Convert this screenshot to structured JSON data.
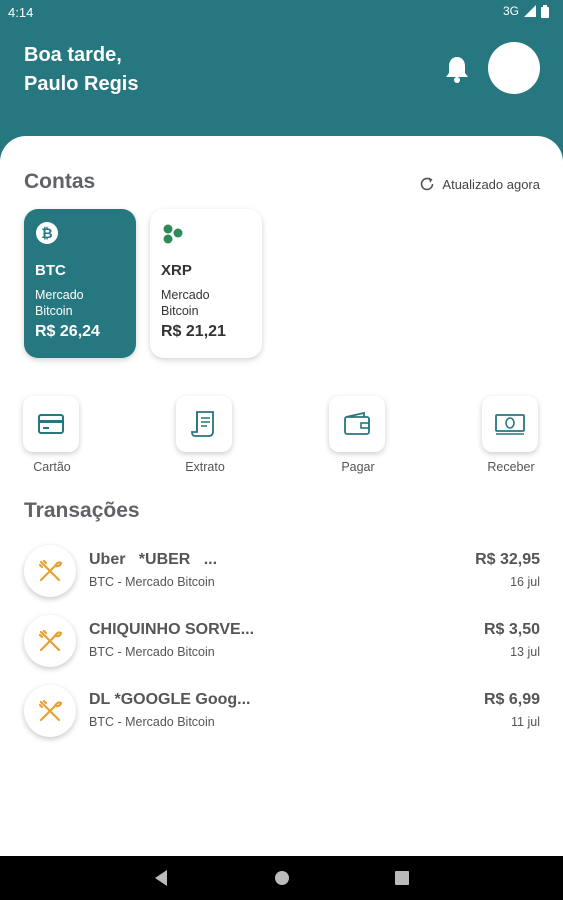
{
  "status": {
    "time": "4:14",
    "network": "3G"
  },
  "header": {
    "greeting_line1": "Boa tarde,",
    "greeting_line2": "Paulo Regis"
  },
  "contas": {
    "title": "Contas",
    "updated": "Atualizado agora",
    "accounts": [
      {
        "symbol": "BTC",
        "exchange_line1": "Mercado",
        "exchange_line2": "Bitcoin",
        "balance": "R$ 26,24"
      },
      {
        "symbol": "XRP",
        "exchange_line1": "Mercado",
        "exchange_line2": "Bitcoin",
        "balance": "R$ 21,21"
      }
    ]
  },
  "actions": [
    {
      "label": "Cartão",
      "icon": "card-icon"
    },
    {
      "label": "Extrato",
      "icon": "receipt-icon"
    },
    {
      "label": "Pagar",
      "icon": "wallet-icon"
    },
    {
      "label": "Receber",
      "icon": "cash-icon"
    }
  ],
  "transactions": {
    "title": "Transações",
    "items": [
      {
        "name": "Uber   *UBER   ...",
        "account": "BTC - Mercado Bitcoin",
        "amount": "R$ 32,95",
        "date": "16 jul"
      },
      {
        "name": "CHIQUINHO SORVE...",
        "account": "BTC - Mercado Bitcoin",
        "amount": "R$ 3,50",
        "date": "13 jul"
      },
      {
        "name": "DL *GOOGLE Goog...",
        "account": "BTC - Mercado Bitcoin",
        "amount": "R$ 6,99",
        "date": "11 jul"
      }
    ]
  },
  "colors": {
    "primary": "#26777f",
    "category_icon": "#e8a030",
    "xrp_green": "#2e8b57"
  }
}
